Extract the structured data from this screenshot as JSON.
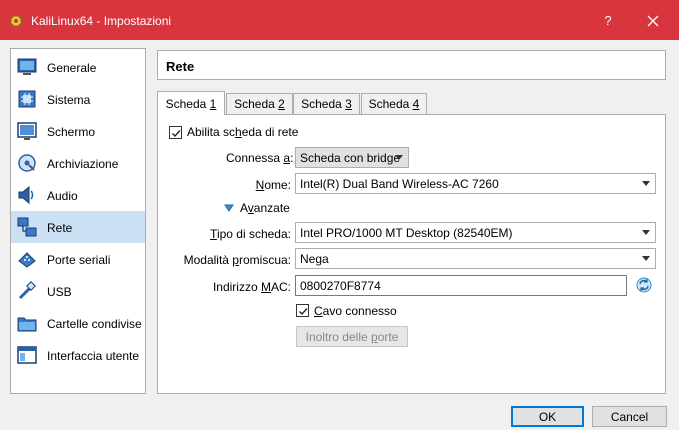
{
  "window": {
    "title": "KaliLinux64 - Impostazioni",
    "help_label": "?"
  },
  "sidebar": {
    "items": [
      {
        "label": "Generale",
        "icon": "general-icon"
      },
      {
        "label": "Sistema",
        "icon": "system-icon"
      },
      {
        "label": "Schermo",
        "icon": "display-icon"
      },
      {
        "label": "Archiviazione",
        "icon": "storage-icon"
      },
      {
        "label": "Audio",
        "icon": "audio-icon"
      },
      {
        "label": "Rete",
        "icon": "network-icon",
        "selected": true
      },
      {
        "label": "Porte seriali",
        "icon": "serial-ports-icon"
      },
      {
        "label": "USB",
        "icon": "usb-icon"
      },
      {
        "label": "Cartelle condivise",
        "icon": "shared-folders-icon"
      },
      {
        "label": "Interfaccia utente",
        "icon": "user-interface-icon"
      }
    ]
  },
  "header": {
    "title": "Rete"
  },
  "tabs": [
    {
      "prefix": "Scheda ",
      "key": "1",
      "active": true
    },
    {
      "prefix": "Scheda ",
      "key": "2"
    },
    {
      "prefix": "Scheda ",
      "key": "3"
    },
    {
      "prefix": "Scheda ",
      "key": "4"
    }
  ],
  "adapter": {
    "enable_label": {
      "pre": "Abilita sc",
      "key": "h",
      "post": "eda di rete"
    },
    "enable_checked": true,
    "attached_label": {
      "pre": "Connessa ",
      "key": "a",
      "post": ":"
    },
    "attached_value": "Scheda con bridge",
    "name_label": {
      "pre": "",
      "key": "N",
      "post": "ome:"
    },
    "name_value": "Intel(R) Dual Band Wireless-AC 7260",
    "advanced_label": {
      "pre": "A",
      "key": "v",
      "post": "anzate"
    },
    "type_label": {
      "pre": "",
      "key": "T",
      "post": "ipo di scheda:"
    },
    "type_value": "Intel PRO/1000 MT Desktop (82540EM)",
    "promisc_label": {
      "pre": "Modalità ",
      "key": "p",
      "post": "romiscua:"
    },
    "promisc_value": "Nega",
    "mac_label": {
      "pre": "Indirizzo ",
      "key": "M",
      "post": "AC:"
    },
    "mac_value": "0800270F8774",
    "cable_label": {
      "pre": "",
      "key": "C",
      "post": "avo connesso"
    },
    "cable_checked": true,
    "port_forwarding_label": {
      "pre": "Inoltro delle ",
      "key": "p",
      "post": "orte"
    }
  },
  "footer": {
    "ok_label": "OK",
    "cancel_label": "Cancel"
  },
  "colors": {
    "titlebar": "#d9353f",
    "selection": "#cce0f5",
    "accent": "#0078d7"
  }
}
